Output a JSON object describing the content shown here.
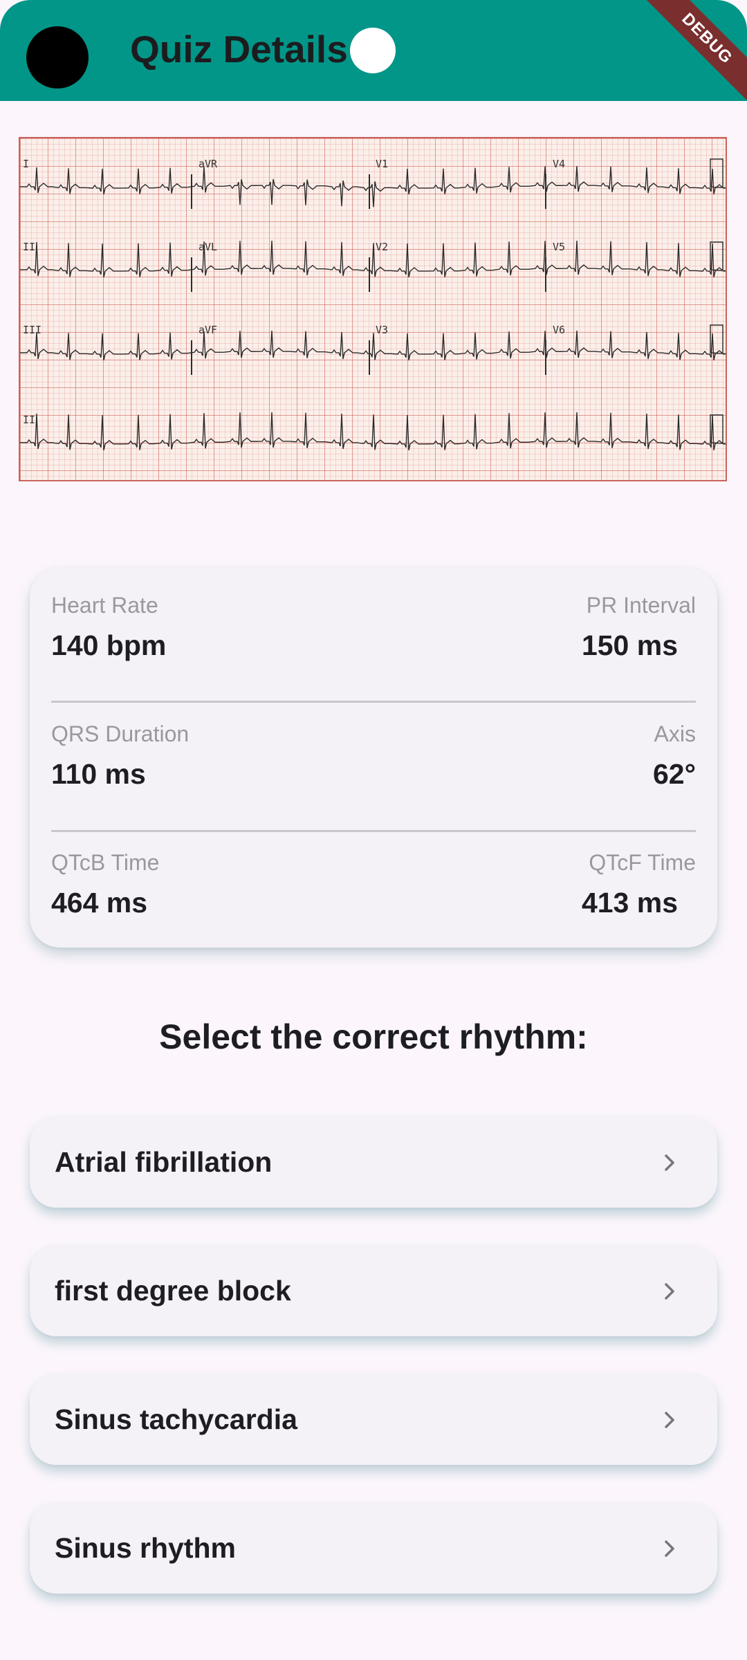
{
  "appbar": {
    "title": "Quiz Details",
    "debug_banner": "DEBUG",
    "colors": {
      "background": "#019688"
    }
  },
  "ecg": {
    "leads": [
      "I",
      "aVR",
      "V1",
      "V4",
      "II",
      "aVL",
      "V2",
      "V5",
      "III",
      "aVF",
      "V3",
      "V6",
      "II"
    ]
  },
  "stats": {
    "heart_rate": {
      "label": "Heart Rate",
      "value": "140 bpm"
    },
    "pr_interval": {
      "label": "PR Interval",
      "value": "150 ms"
    },
    "qrs_duration": {
      "label": "QRS Duration",
      "value": "110 ms"
    },
    "axis": {
      "label": "Axis",
      "value": "62°"
    },
    "qtcb_time": {
      "label": "QTcB Time",
      "value": "464 ms"
    },
    "qtcf_time": {
      "label": "QTcF Time",
      "value": "413 ms"
    }
  },
  "prompt": "Select the correct rhythm:",
  "options": [
    {
      "label": "Atrial fibrillation",
      "icon": "chevron-right-icon"
    },
    {
      "label": "first degree block",
      "icon": "chevron-right-icon"
    },
    {
      "label": "Sinus tachycardia",
      "icon": "chevron-right-icon"
    },
    {
      "label": "Sinus rhythm",
      "icon": "chevron-right-icon"
    }
  ]
}
